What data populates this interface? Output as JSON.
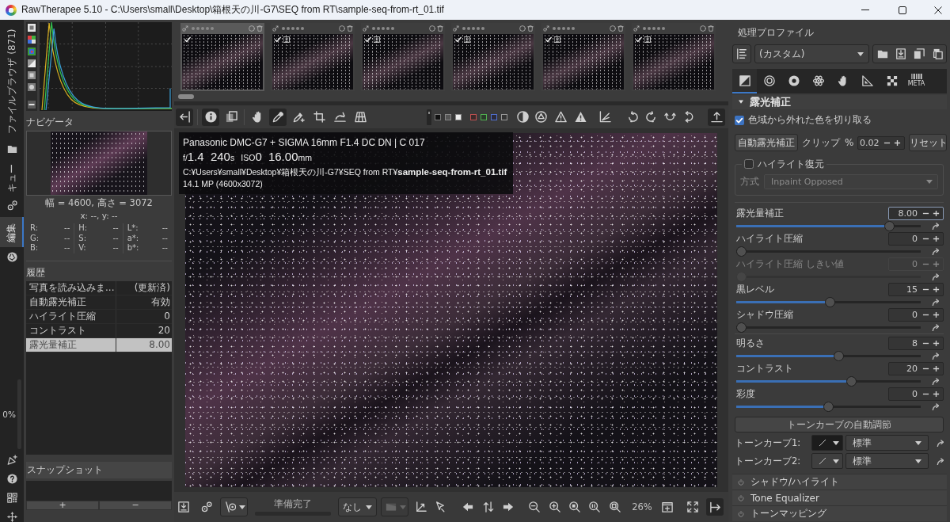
{
  "window": {
    "title": "RawTherapee 5.10 - C:\\Users\\small\\Desktop\\箱根天の川-G7\\SEQ from RT\\sample-seq-from-rt_01.tif"
  },
  "side_tabs": [
    {
      "label": "ファイルブラウザ (871)",
      "selected": false
    },
    {
      "label": "キュー",
      "selected": false
    },
    {
      "label": "編集",
      "selected": true
    }
  ],
  "side_progress": {
    "label": "0%"
  },
  "navigator": {
    "title": "ナビゲータ",
    "size": "幅 = 4600, 高さ = 3072",
    "cursor": "x: --, y: --",
    "readouts": [
      [
        {
          "label": "R:",
          "value": "--"
        },
        {
          "label": "H:",
          "value": "--"
        },
        {
          "label": "L*:",
          "value": "--"
        }
      ],
      [
        {
          "label": "G:",
          "value": "--"
        },
        {
          "label": "S:",
          "value": "--"
        },
        {
          "label": "a*:",
          "value": "--"
        }
      ],
      [
        {
          "label": "B:",
          "value": "--"
        },
        {
          "label": "V:",
          "value": "--"
        },
        {
          "label": "b*:",
          "value": "--"
        }
      ]
    ]
  },
  "history": {
    "title": "履歴",
    "rows": [
      {
        "action": "写真を読み込みま...",
        "value": "(更新済)",
        "selected": false
      },
      {
        "action": "自動露光補正",
        "value": "有効",
        "selected": false
      },
      {
        "action": "ハイライト圧縮",
        "value": "0",
        "selected": false
      },
      {
        "action": "コントラスト",
        "value": "20",
        "selected": false
      },
      {
        "action": "露光量補正",
        "value": "8.00",
        "selected": true
      }
    ]
  },
  "snapshots": {
    "title": "スナップショット",
    "buttons": [
      "+",
      "−"
    ]
  },
  "filmstrip": [
    {
      "selected": true,
      "checked": true,
      "saved": false,
      "stars": 0
    },
    {
      "selected": false,
      "checked": true,
      "saved": true,
      "stars": 0
    },
    {
      "selected": false,
      "checked": true,
      "saved": true,
      "stars": 0
    },
    {
      "selected": false,
      "checked": true,
      "saved": true,
      "stars": 0
    },
    {
      "selected": false,
      "checked": true,
      "saved": true,
      "stars": 0
    },
    {
      "selected": false,
      "checked": true,
      "saved": true,
      "stars": 0
    }
  ],
  "toolbar": {
    "tools": [
      {
        "selected": true
      },
      {
        "selected": false
      },
      {
        "selected": false
      },
      {
        "selected": true
      },
      {
        "selected": false
      },
      {
        "selected": false
      },
      {
        "selected": false
      },
      {
        "selected": false
      }
    ]
  },
  "image_info": {
    "camera": "Panasonic DMC-G7 + SIGMA 16mm F1.4 DC DN | C 017",
    "aperture": {
      "prefix": "f/",
      "value": "1.4"
    },
    "shutter": {
      "value": "240",
      "unit": "s"
    },
    "iso": {
      "prefix": "ISO",
      "value": "0"
    },
    "focal_length": {
      "value": "16.00",
      "unit": "mm"
    },
    "path": "C:¥Users¥small¥Desktop¥箱根天の川-G7¥SEQ from RT¥**sample-seq-from-rt_01.tif**",
    "resolution": "14.1 MP (4600x3072)"
  },
  "bottom_bar": {
    "status": "準備完了",
    "preview_mode": "なし",
    "zoom": "26%"
  },
  "profile": {
    "title": "処理プロファイル",
    "value": "(カスタム)"
  },
  "tool_tabs": [
    {
      "selected": true
    },
    {
      "selected": false
    },
    {
      "selected": false
    },
    {
      "selected": false
    },
    {
      "selected": false
    },
    {
      "selected": false
    },
    {
      "selected": false
    },
    {
      "selected": false,
      "caption": "META"
    }
  ],
  "exposure": {
    "title": "露光補正",
    "expanded": true,
    "clip_gamut": {
      "label": "色域から外れた色を切り取る",
      "checked": true
    },
    "auto_button": "自動露光補正",
    "clip_label": "クリップ",
    "clip_unit": "%",
    "clip_value": "0.02",
    "reset_button": "リセット",
    "highlight_recovery": {
      "label": "ハイライト復元",
      "checked": false,
      "method_label": "方式",
      "method_value": "Inpaint Opposed",
      "disabled": true
    },
    "slider_groups": [
      {
        "sliders": [
          {
            "label": "露光量補正",
            "value": "8.00",
            "level": 0.85,
            "disabled": false,
            "focused": true
          },
          {
            "label": "ハイライト圧縮",
            "value": "0",
            "level": 0,
            "disabled": false,
            "focused": false
          },
          {
            "label": "ハイライト圧縮 しきい値",
            "value": "0",
            "level": 0,
            "disabled": true,
            "focused": false
          },
          {
            "label": "黒レベル",
            "value": "15",
            "level": 0.51,
            "disabled": false,
            "focused": false
          },
          {
            "label": "シャドウ圧縮",
            "value": "0",
            "level": 0,
            "disabled": false,
            "focused": false
          }
        ]
      },
      {
        "sliders": [
          {
            "label": "明るさ",
            "value": "8",
            "level": 0.56,
            "disabled": false,
            "focused": false
          },
          {
            "label": "コントラスト",
            "value": "20",
            "level": 0.63,
            "disabled": false,
            "focused": false
          },
          {
            "label": "彩度",
            "value": "0",
            "level": 0.5,
            "disabled": false,
            "focused": false
          }
        ]
      }
    ],
    "auto_tone_button": "トーンカーブの自動調節",
    "curves": [
      {
        "label": "トーンカーブ1:",
        "selected": true,
        "value": "標準"
      },
      {
        "label": "トーンカーブ2:",
        "selected": false,
        "value": "標準"
      }
    ]
  },
  "collapsed_tools": [
    "シャドウ/ハイライト",
    "Tone Equalizer",
    "トーンマッピング"
  ]
}
